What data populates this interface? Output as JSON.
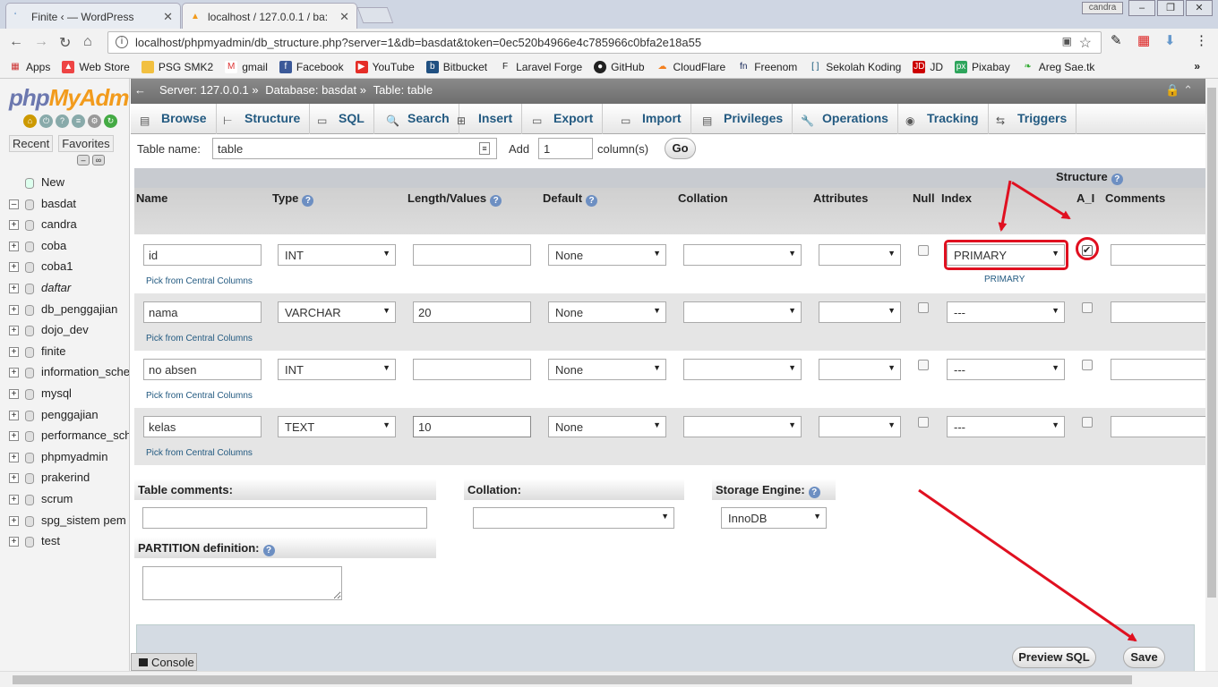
{
  "browser": {
    "tabs": [
      {
        "title": "Finite ‹ — WordPress",
        "icon": "wordpress-icon"
      },
      {
        "title": "localhost / 127.0.0.1 / ba:",
        "icon": "phpmyadmin-icon"
      }
    ],
    "profile": "candra",
    "url": "localhost/phpmyadmin/db_structure.php?server=1&db=basdat&token=0ec520b4966e4c785966c0bfa2e18a55",
    "bookmarks": [
      "Apps",
      "Web Store",
      "PSG SMK2",
      "gmail",
      "Facebook",
      "YouTube",
      "Bitbucket",
      "Laravel Forge",
      "GitHub",
      "CloudFlare",
      "Freenom",
      "Sekolah Koding",
      "JD",
      "Pixabay",
      "Areg Sae.tk"
    ],
    "more_bookmarks": "»"
  },
  "sidebar": {
    "logo_php": "php",
    "logo_my": "MyAdm",
    "tabs": [
      "Recent",
      "Favorites"
    ],
    "new_label": "New",
    "databases": [
      "basdat",
      "candra",
      "coba",
      "coba1",
      "daftar",
      "db_penggajian",
      "dojo_dev",
      "finite",
      "information_sche",
      "mysql",
      "penggajian",
      "performance_sch",
      "phpmyadmin",
      "prakerind",
      "scrum",
      "spg_sistem pem",
      "test"
    ]
  },
  "breadcrumb": {
    "server": "Server: 127.0.0.1 »",
    "database": "Database: basdat »",
    "table": "Table: table"
  },
  "menu": [
    "Browse",
    "Structure",
    "SQL",
    "Search",
    "Insert",
    "Export",
    "Import",
    "Privileges",
    "Operations",
    "Tracking",
    "Triggers"
  ],
  "form": {
    "table_name_label": "Table name:",
    "table_name_value": "table",
    "add_label": "Add",
    "add_value": "1",
    "columns_label": "column(s)",
    "go_label": "Go"
  },
  "columns_header": {
    "structure": "Structure",
    "name": "Name",
    "type": "Type",
    "length": "Length/Values",
    "default": "Default",
    "collation": "Collation",
    "attributes": "Attributes",
    "null": "Null",
    "index": "Index",
    "ai": "A_I",
    "comments": "Comments"
  },
  "rows": [
    {
      "name": "id",
      "type": "INT",
      "length": "",
      "default": "None",
      "index": "PRIMARY",
      "index_note": "PRIMARY",
      "ai": true,
      "pick": "Pick from Central Columns"
    },
    {
      "name": "nama",
      "type": "VARCHAR",
      "length": "20",
      "default": "None",
      "index": "---",
      "index_note": "",
      "ai": false,
      "pick": "Pick from Central Columns"
    },
    {
      "name": "no absen",
      "type": "INT",
      "length": "",
      "default": "None",
      "index": "---",
      "index_note": "",
      "ai": false,
      "pick": "Pick from Central Columns"
    },
    {
      "name": "kelas",
      "type": "TEXT",
      "length": "10",
      "default": "None",
      "index": "---",
      "index_note": "",
      "ai": false,
      "pick": "Pick from Central Columns"
    }
  ],
  "bottom": {
    "table_comments": "Table comments:",
    "collation": "Collation:",
    "storage_engine": "Storage Engine:",
    "storage_engine_value": "InnoDB",
    "partition": "PARTITION definition:"
  },
  "buttons": {
    "preview_sql": "Preview SQL",
    "save": "Save"
  },
  "console": "Console",
  "colors": {
    "annotation": "#e01020",
    "link": "#235a81",
    "php_logo": "#6c78af",
    "my_logo": "#f29b1c"
  }
}
